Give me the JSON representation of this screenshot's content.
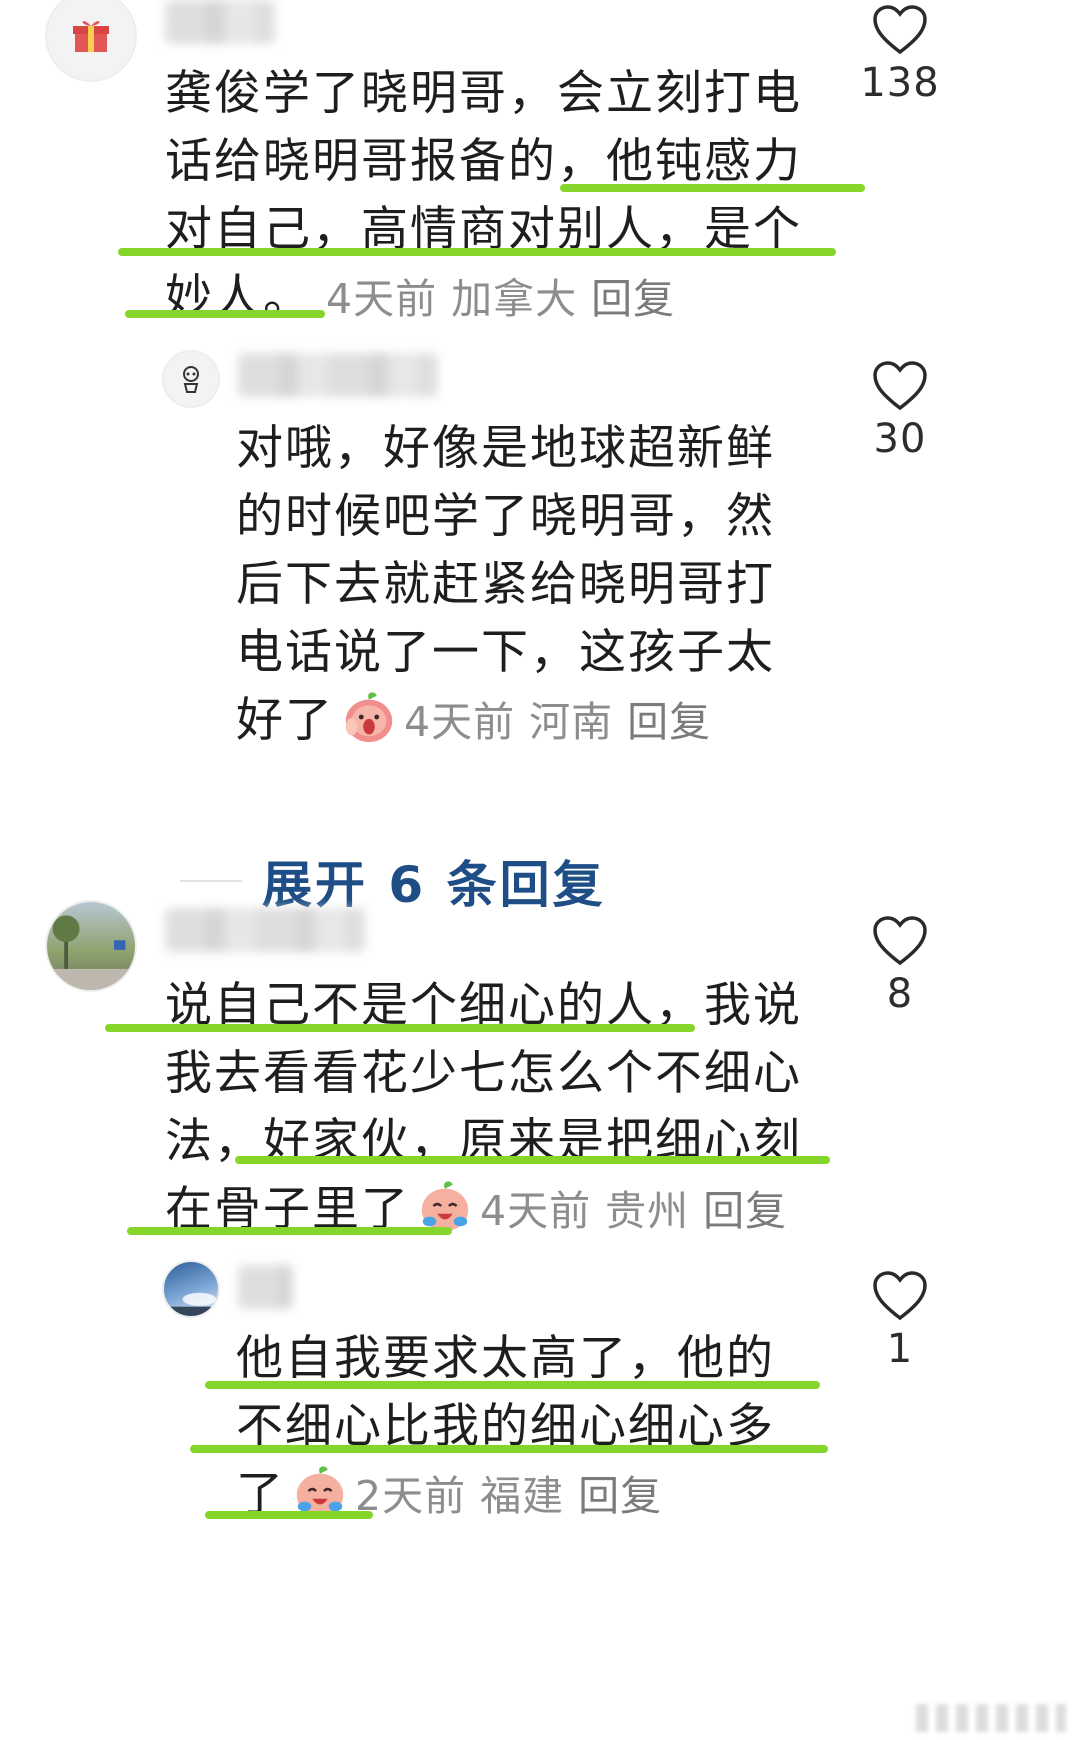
{
  "comments": [
    {
      "avatar": "gift-icon",
      "text": "龚俊学了晓明哥，会立刻打电话给晓明哥报备的，他钝感力对自己，高情商对别人，是个妙人。",
      "time": "4天前",
      "location": "加拿大",
      "reply_label": "回复",
      "likes": "138"
    },
    {
      "avatar": "robot-avatar",
      "text": "对哦，好像是地球超新鲜的时候吧学了晓明哥，然后下去就赶紧给晓明哥打电话说了一下，这孩子太好了",
      "emoji": "shy-peach-emoji",
      "time": "4天前",
      "location": "河南",
      "reply_label": "回复",
      "likes": "30"
    },
    {
      "avatar": "street-photo-avatar",
      "text": "说自己不是个细心的人，我说我去看看花少七怎么个不细心法，好家伙，原来是把细心刻在骨子里了",
      "emoji": "crying-laugh-peach-emoji",
      "time": "4天前",
      "location": "贵州",
      "reply_label": "回复",
      "likes": "8"
    },
    {
      "avatar": "sky-photo-avatar",
      "text": "他自我要求太高了，他的不细心比我的细心细心多了",
      "emoji": "crying-laugh-peach-emoji",
      "time": "2天前",
      "location": "福建",
      "reply_label": "回复",
      "likes": "1"
    }
  ],
  "expand_replies": {
    "label": "展开 6 条回复"
  },
  "colors": {
    "highlight": "#86d52a",
    "link": "#1f4e86",
    "meta": "#8d8d8d"
  }
}
